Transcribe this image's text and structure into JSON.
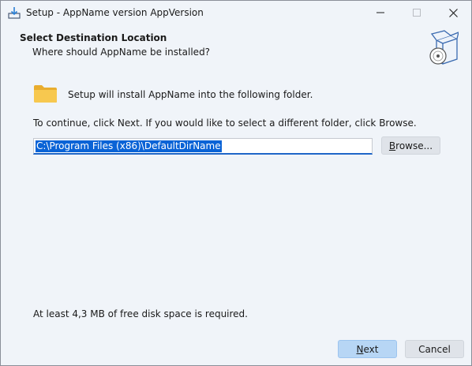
{
  "window": {
    "title": "Setup - AppName version AppVersion"
  },
  "header": {
    "title": "Select Destination Location",
    "subtitle": "Where should AppName be installed?"
  },
  "content": {
    "install_text": "Setup will install AppName into the following folder.",
    "continue_text": "To continue, click Next. If you would like to select a different folder, click Browse.",
    "directory_value": "C:\\Program Files (x86)\\DefaultDirName",
    "browse_label_underlined": "B",
    "browse_label_rest": "rowse...",
    "disk_space_text": "At least 4,3 MB of free disk space is required."
  },
  "buttons": {
    "next_label_underlined": "N",
    "next_label_rest": "ext",
    "cancel_label": "Cancel"
  },
  "icons": {
    "app": "installer-download-icon",
    "folder": "folder-icon",
    "wizard": "software-box-disc-icon",
    "minimize": "minimize-icon",
    "maximize": "maximize-icon",
    "close": "close-icon"
  },
  "colors": {
    "background": "#f0f4f9",
    "accent": "#1f66c8",
    "selection": "#0a63d6",
    "default_button": "#b7d6f5",
    "button": "#dfe3e9",
    "folder": "#f4c54d"
  }
}
